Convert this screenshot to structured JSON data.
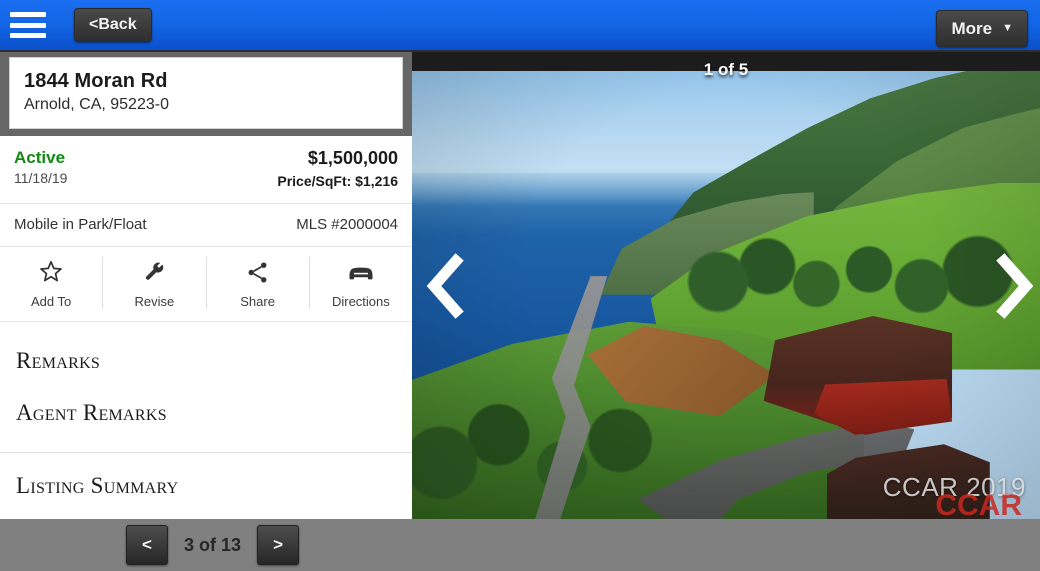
{
  "header": {
    "menu_icon": "hamburger-menu-icon",
    "back_label": "<Back",
    "more_label": "More",
    "more_caret": "▼",
    "accent_color": "#1267e6"
  },
  "listing": {
    "address_line1": "1844 Moran Rd",
    "address_line2": "Arnold, CA, 95223-0",
    "status": "Active",
    "status_color": "#128a12",
    "status_date": "11/18/19",
    "price": "$1,500,000",
    "price_per_sqft": "Price/SqFt: $1,216",
    "property_type": "Mobile in Park/Float",
    "mls": "MLS #2000004"
  },
  "actions": [
    {
      "label": "Add To",
      "icon": "star-outline-icon"
    },
    {
      "label": "Revise",
      "icon": "wrench-icon"
    },
    {
      "label": "Share",
      "icon": "share-nodes-icon"
    },
    {
      "label": "Directions",
      "icon": "car-icon"
    }
  ],
  "sections": [
    {
      "title": "Remarks"
    },
    {
      "title": "Agent Remarks"
    },
    {
      "title": "Listing Summary"
    }
  ],
  "photo": {
    "counter": "1 of 5",
    "watermark": "CCAR 2019",
    "watermark_overlay": "CCAR",
    "prev_icon": "chevron-left-icon",
    "next_icon": "chevron-right-icon"
  },
  "footer": {
    "prev_label": "<",
    "next_label": ">",
    "page_label": "3 of 13"
  }
}
